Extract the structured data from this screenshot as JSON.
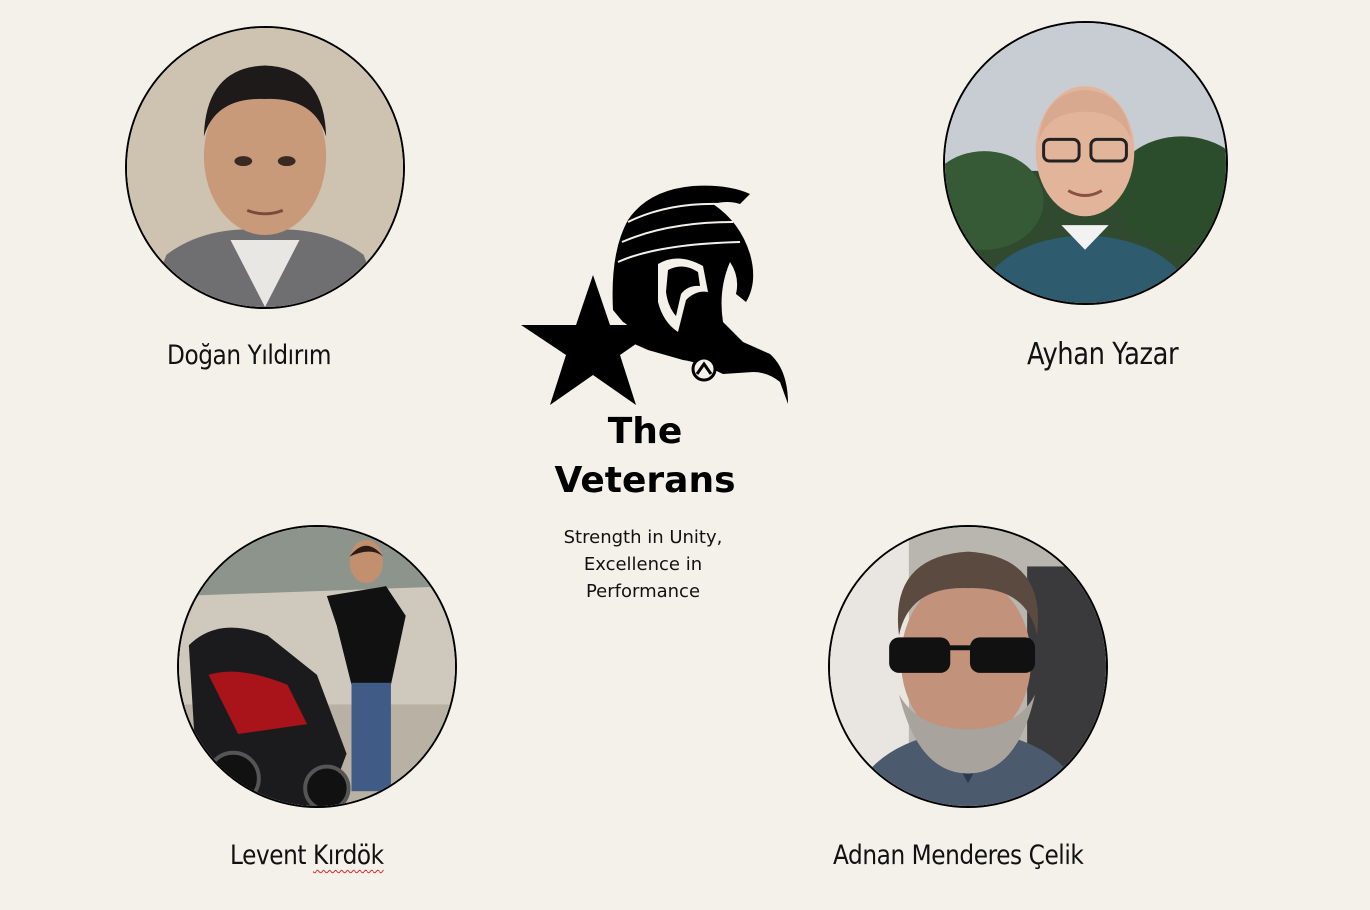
{
  "members": [
    {
      "name": "Doğan Yıldırım"
    },
    {
      "name": "Ayhan Yazar"
    },
    {
      "name": "Levent",
      "surname": "Kırdök"
    },
    {
      "name": "Adnan Menderes Çelik"
    }
  ],
  "team": {
    "title_line1": "The",
    "title_line2": "Veterans",
    "tagline": "Strength in Unity, Excellence in Performance"
  },
  "colors": {
    "background": "#f4f1ea",
    "outline": "#000000",
    "text": "#111111"
  },
  "icons": {
    "logo": "spartan-helmet-icon",
    "star": "star-icon"
  }
}
